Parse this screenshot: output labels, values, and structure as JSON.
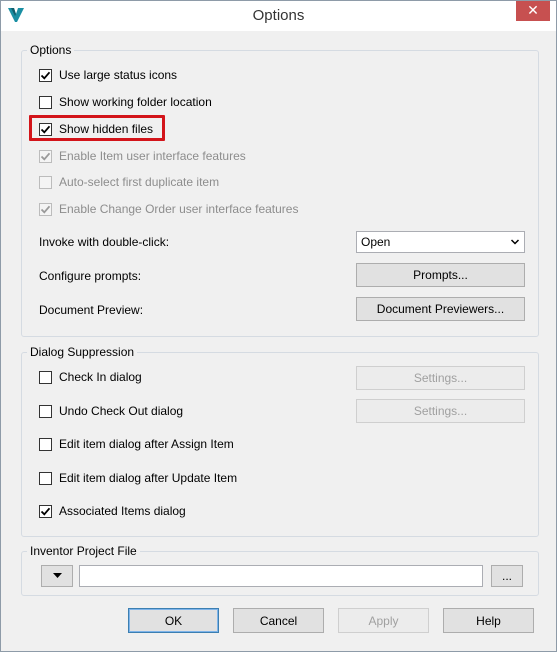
{
  "window": {
    "title": "Options",
    "close_label": "✕"
  },
  "options_group": {
    "legend": "Options",
    "checkboxes": [
      {
        "label": "Use large status icons",
        "checked": true,
        "enabled": true
      },
      {
        "label": "Show working folder location",
        "checked": false,
        "enabled": true
      },
      {
        "label": "Show hidden files",
        "checked": true,
        "enabled": true
      },
      {
        "label": "Enable Item user interface features",
        "checked": true,
        "enabled": false
      },
      {
        "label": "Auto-select first duplicate item",
        "checked": false,
        "enabled": false
      },
      {
        "label": "Enable Change Order user interface features",
        "checked": true,
        "enabled": false
      }
    ],
    "invoke_label": "Invoke with double-click:",
    "invoke_value": "Open",
    "prompts_label": "Configure prompts:",
    "prompts_button": "Prompts...",
    "preview_label": "Document Preview:",
    "preview_button": "Document Previewers..."
  },
  "dialog_suppression": {
    "legend": "Dialog Suppression",
    "items": [
      {
        "label": "Check In dialog",
        "checked": false,
        "settings": "Settings..."
      },
      {
        "label": "Undo Check Out dialog",
        "checked": false,
        "settings": "Settings..."
      },
      {
        "label": "Edit item dialog after Assign Item",
        "checked": false
      },
      {
        "label": "Edit item dialog after Update Item",
        "checked": false
      },
      {
        "label": "Associated Items dialog",
        "checked": true
      }
    ]
  },
  "project_file": {
    "legend": "Inventor Project File",
    "value": "",
    "browse_label": "..."
  },
  "footer": {
    "ok": "OK",
    "cancel": "Cancel",
    "apply": "Apply",
    "help": "Help"
  },
  "colors": {
    "highlight": "#d3141a",
    "logo": "#1a8fa3"
  }
}
